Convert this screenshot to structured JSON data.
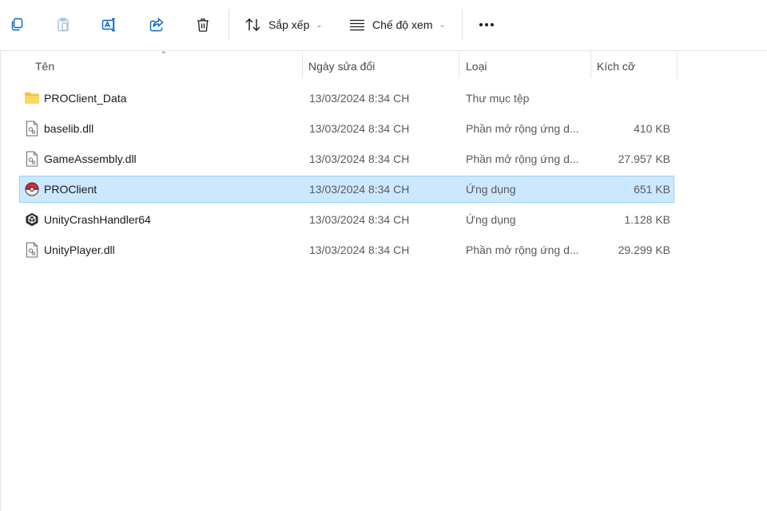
{
  "toolbar": {
    "copy_icon": "copy-icon",
    "paste_icon": "paste-icon",
    "rename_icon": "rename-icon",
    "share_icon": "share-icon",
    "delete_icon": "delete-icon",
    "sort_label": "Sắp xếp",
    "view_label": "Chế độ xem",
    "more_icon": "more-icon"
  },
  "columns": {
    "name": "Tên",
    "date": "Ngày sửa đổi",
    "type": "Loại",
    "size": "Kích cỡ"
  },
  "files": [
    {
      "name": "PROClient_Data",
      "date": "13/03/2024 8:34 CH",
      "type": "Thư mục tệp",
      "size": "",
      "icon": "folder-icon"
    },
    {
      "name": "baselib.dll",
      "date": "13/03/2024 8:34 CH",
      "type": "Phần mở rộng ứng d...",
      "size": "410 KB",
      "icon": "dll-file-icon"
    },
    {
      "name": "GameAssembly.dll",
      "date": "13/03/2024 8:34 CH",
      "type": "Phần mở rộng ứng d...",
      "size": "27.957 KB",
      "icon": "dll-file-icon"
    },
    {
      "name": "PROClient",
      "date": "13/03/2024 8:34 CH",
      "type": "Ứng dụng",
      "size": "651 KB",
      "icon": "pokeball-app-icon",
      "selected": true
    },
    {
      "name": "UnityCrashHandler64",
      "date": "13/03/2024 8:34 CH",
      "type": "Ứng dụng",
      "size": "1.128 KB",
      "icon": "unity-app-icon"
    },
    {
      "name": "UnityPlayer.dll",
      "date": "13/03/2024 8:34 CH",
      "type": "Phần mở rộng ứng d...",
      "size": "29.299 KB",
      "icon": "dll-file-icon"
    }
  ],
  "colors": {
    "accent": "#0067c0",
    "selection_bg": "#cce8ff",
    "selection_border": "#99d1ff",
    "folder": "#f5c242"
  }
}
